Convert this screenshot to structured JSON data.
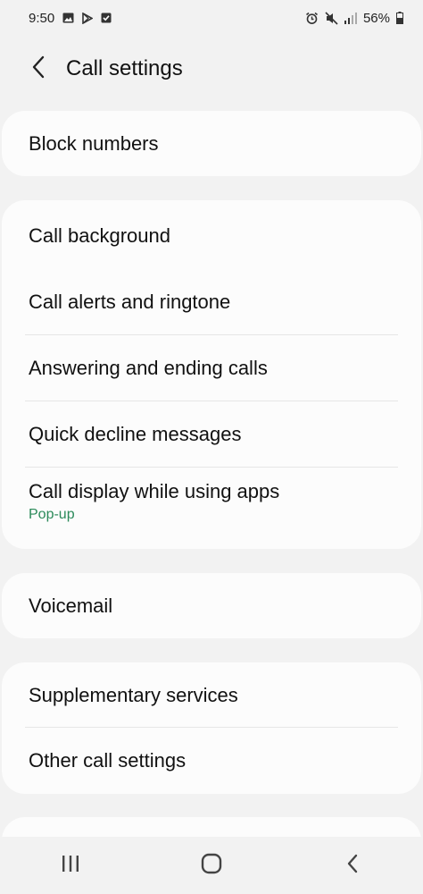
{
  "status_bar": {
    "time": "9:50",
    "battery": "56%",
    "left_icons": [
      "image-icon",
      "play-store-icon",
      "checkbox-icon"
    ],
    "right_icons": [
      "alarm-icon",
      "mute-icon",
      "signal-icon",
      "battery-icon"
    ]
  },
  "header": {
    "title": "Call settings",
    "back_icon": "back-arrow-icon"
  },
  "groups": [
    {
      "items": [
        {
          "label": "Block numbers"
        }
      ]
    },
    {
      "items": [
        {
          "label": "Call background"
        },
        {
          "label": "Call alerts and ringtone"
        },
        {
          "label": "Answering and ending calls"
        },
        {
          "label": "Quick decline messages"
        },
        {
          "label": "Call display while using apps",
          "sublabel": "Pop-up"
        }
      ]
    },
    {
      "items": [
        {
          "label": "Voicemail"
        }
      ]
    },
    {
      "items": [
        {
          "label": "Supplementary services"
        },
        {
          "label": "Other call settings"
        }
      ]
    }
  ],
  "colors": {
    "background": "#f2f2f2",
    "card": "#fcfcfc",
    "accent": "#2b8a5a"
  },
  "nav_bar": {
    "icons": [
      "recent-apps-icon",
      "home-icon",
      "back-icon"
    ]
  }
}
